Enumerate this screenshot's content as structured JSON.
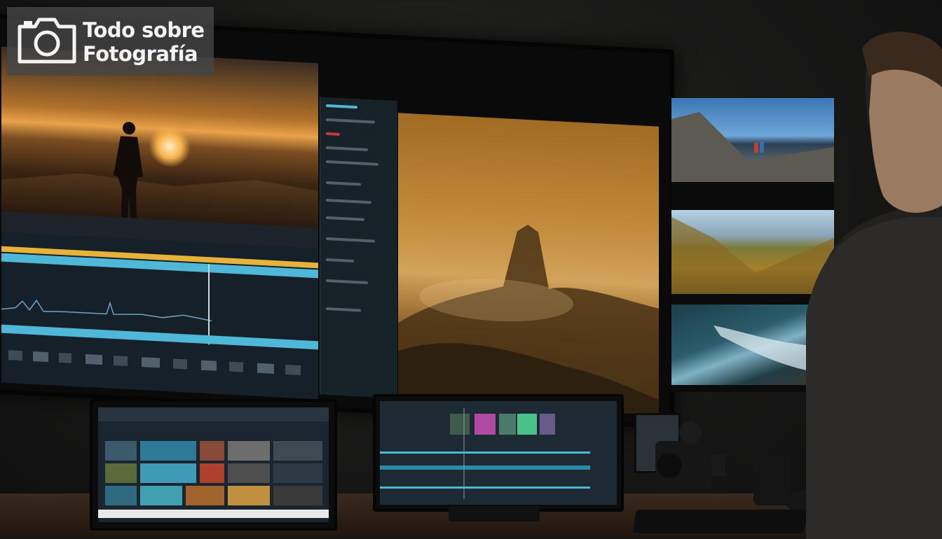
{
  "logo": {
    "line1": "Todo sobre",
    "line2": "Fotografía",
    "icon": "camera-icon"
  },
  "scene": {
    "description_icons": [
      "sunset-hiker-photo",
      "misty-rock-photo",
      "coastal-hikers-thumb",
      "hillside-thumb",
      "ocean-waves-thumb"
    ]
  },
  "colors": {
    "timeline_cyan": "#4fb8d8",
    "timeline_yellow": "#e7b23a",
    "warm_accent": "#c28a3a"
  }
}
